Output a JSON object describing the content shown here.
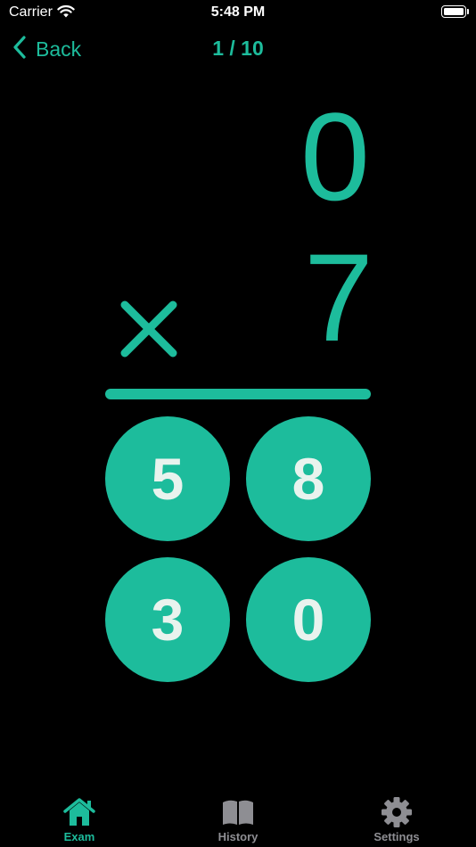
{
  "status_bar": {
    "carrier": "Carrier",
    "time": "5:48 PM",
    "wifi_icon": "wifi-icon",
    "battery_icon": "battery-full-icon"
  },
  "nav": {
    "back_label": "Back",
    "back_icon": "chevron-left-icon",
    "progress": "1 / 10"
  },
  "problem": {
    "top_operand": "0",
    "bottom_operand": "7",
    "operator_icon": "multiply-icon"
  },
  "answers": [
    {
      "label": "5"
    },
    {
      "label": "8"
    },
    {
      "label": "3"
    },
    {
      "label": "0"
    }
  ],
  "tabs": [
    {
      "label": "Exam",
      "icon": "home-icon",
      "active": true
    },
    {
      "label": "History",
      "icon": "book-icon",
      "active": false
    },
    {
      "label": "Settings",
      "icon": "gear-icon",
      "active": false
    }
  ],
  "colors": {
    "accent": "#1dbc9c",
    "background": "#000000",
    "button_text": "#e9f3ee",
    "inactive_tab": "#8e8e93"
  }
}
